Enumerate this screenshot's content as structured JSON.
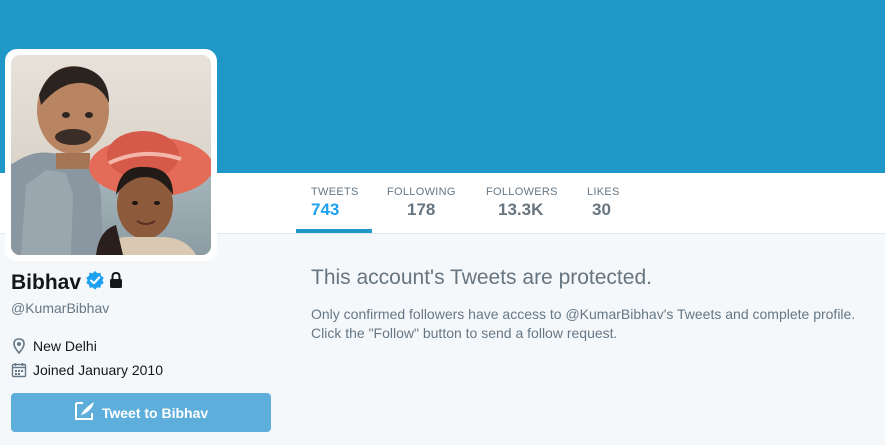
{
  "colors": {
    "banner": "#1f97c7",
    "accent": "#1da1f2",
    "tweet_button": "#5eaedb"
  },
  "profile": {
    "name": "Bibhav",
    "handle": "@KumarBibhav",
    "verified": true,
    "protected": true,
    "location": "New Delhi",
    "joined": "Joined January 2010",
    "avatar_icon": "profile-photo"
  },
  "nav": {
    "stats": [
      {
        "label": "TWEETS",
        "value": "743",
        "active": true
      },
      {
        "label": "FOLLOWING",
        "value": "178",
        "active": false
      },
      {
        "label": "FOLLOWERS",
        "value": "13.3K",
        "active": false
      },
      {
        "label": "LIKES",
        "value": "30",
        "active": false
      }
    ]
  },
  "actions": {
    "tweet_to": "Tweet to Bibhav"
  },
  "protected_notice": {
    "title": "This account's Tweets are protected.",
    "line1": "Only confirmed followers have access to @KumarBibhav's Tweets and complete profile.",
    "line2": "Click the \"Follow\" button to send a follow request."
  }
}
